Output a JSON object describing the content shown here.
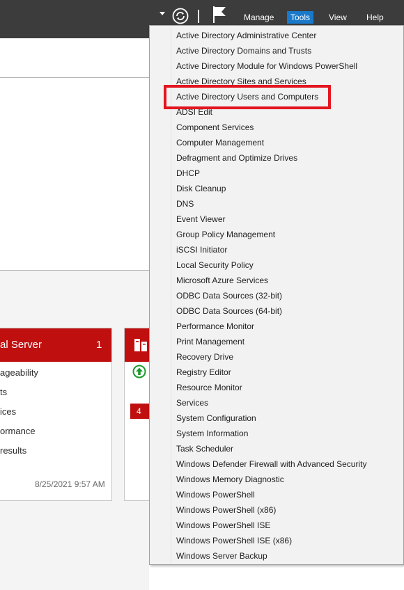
{
  "topbar": {
    "menu": [
      {
        "label": "Manage"
      },
      {
        "label": "Tools"
      },
      {
        "label": "View"
      },
      {
        "label": "Help"
      }
    ],
    "icons": [
      "dropdown-arrow-icon",
      "refresh-icon",
      "flag-icon"
    ]
  },
  "tile": {
    "title": "al Server",
    "count": "1",
    "rows": [
      "ageability",
      "ts",
      "ices",
      "ormance",
      "results"
    ],
    "date": "8/25/2021 9:57 AM"
  },
  "tile2": {
    "badge": "4"
  },
  "tools_menu": {
    "items": [
      "Active Directory Administrative Center",
      "Active Directory Domains and Trusts",
      "Active Directory Module for Windows PowerShell",
      "Active Directory Sites and Services",
      "Active Directory Users and Computers",
      "ADSI Edit",
      "Component Services",
      "Computer Management",
      "Defragment and Optimize Drives",
      "DHCP",
      "Disk Cleanup",
      "DNS",
      "Event Viewer",
      "Group Policy Management",
      "iSCSI Initiator",
      "Local Security Policy",
      "Microsoft Azure Services",
      "ODBC Data Sources (32-bit)",
      "ODBC Data Sources (64-bit)",
      "Performance Monitor",
      "Print Management",
      "Recovery Drive",
      "Registry Editor",
      "Resource Monitor",
      "Services",
      "System Configuration",
      "System Information",
      "Task Scheduler",
      "Windows Defender Firewall with Advanced Security",
      "Windows Memory Diagnostic",
      "Windows PowerShell",
      "Windows PowerShell (x86)",
      "Windows PowerShell ISE",
      "Windows PowerShell ISE (x86)",
      "Windows Server Backup"
    ],
    "highlighted_item": "Active Directory Users and Computers"
  },
  "colors": {
    "topbar": "#3c3c3c",
    "active_menu": "#1979ca",
    "tile_header": "#c00f0f",
    "highlight_box": "#e3151f"
  }
}
